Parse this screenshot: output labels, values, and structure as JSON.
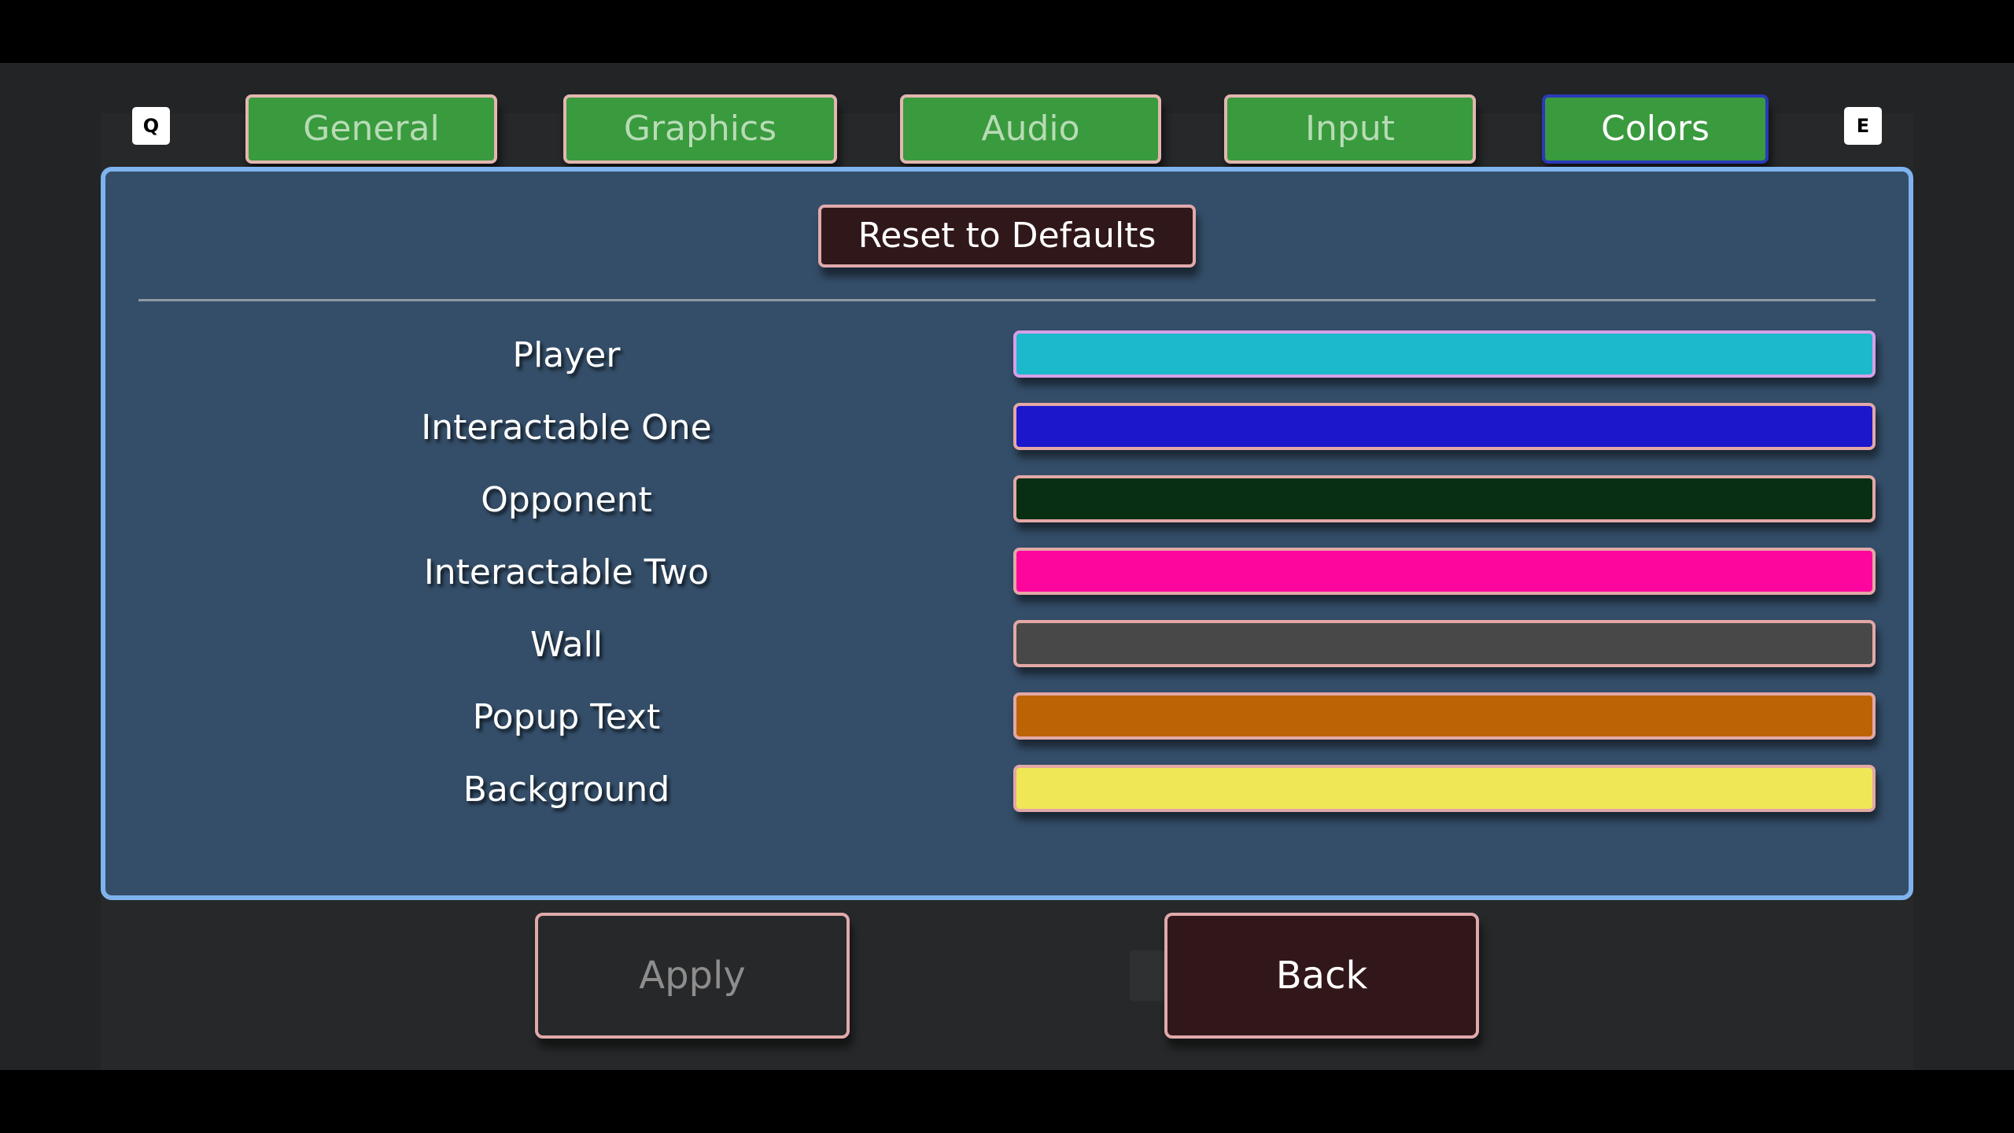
{
  "hints": {
    "prev_key": "Q",
    "next_key": "E"
  },
  "tabs": [
    {
      "label": "General"
    },
    {
      "label": "Graphics"
    },
    {
      "label": "Audio"
    },
    {
      "label": "Input"
    },
    {
      "label": "Colors",
      "active": true
    }
  ],
  "actions": {
    "reset_label": "Reset to Defaults",
    "apply_label": "Apply",
    "back_label": "Back"
  },
  "colors": [
    {
      "label": "Player",
      "color": "#1cb8cc"
    },
    {
      "label": "Interactable One",
      "color": "#1d17cc"
    },
    {
      "label": "Opponent",
      "color": "#082e14"
    },
    {
      "label": "Interactable Two",
      "color": "#fc069e"
    },
    {
      "label": "Wall",
      "color": "#484848"
    },
    {
      "label": "Popup Text",
      "color": "#bc6405"
    },
    {
      "label": "Background",
      "color": "#efe756"
    }
  ]
}
